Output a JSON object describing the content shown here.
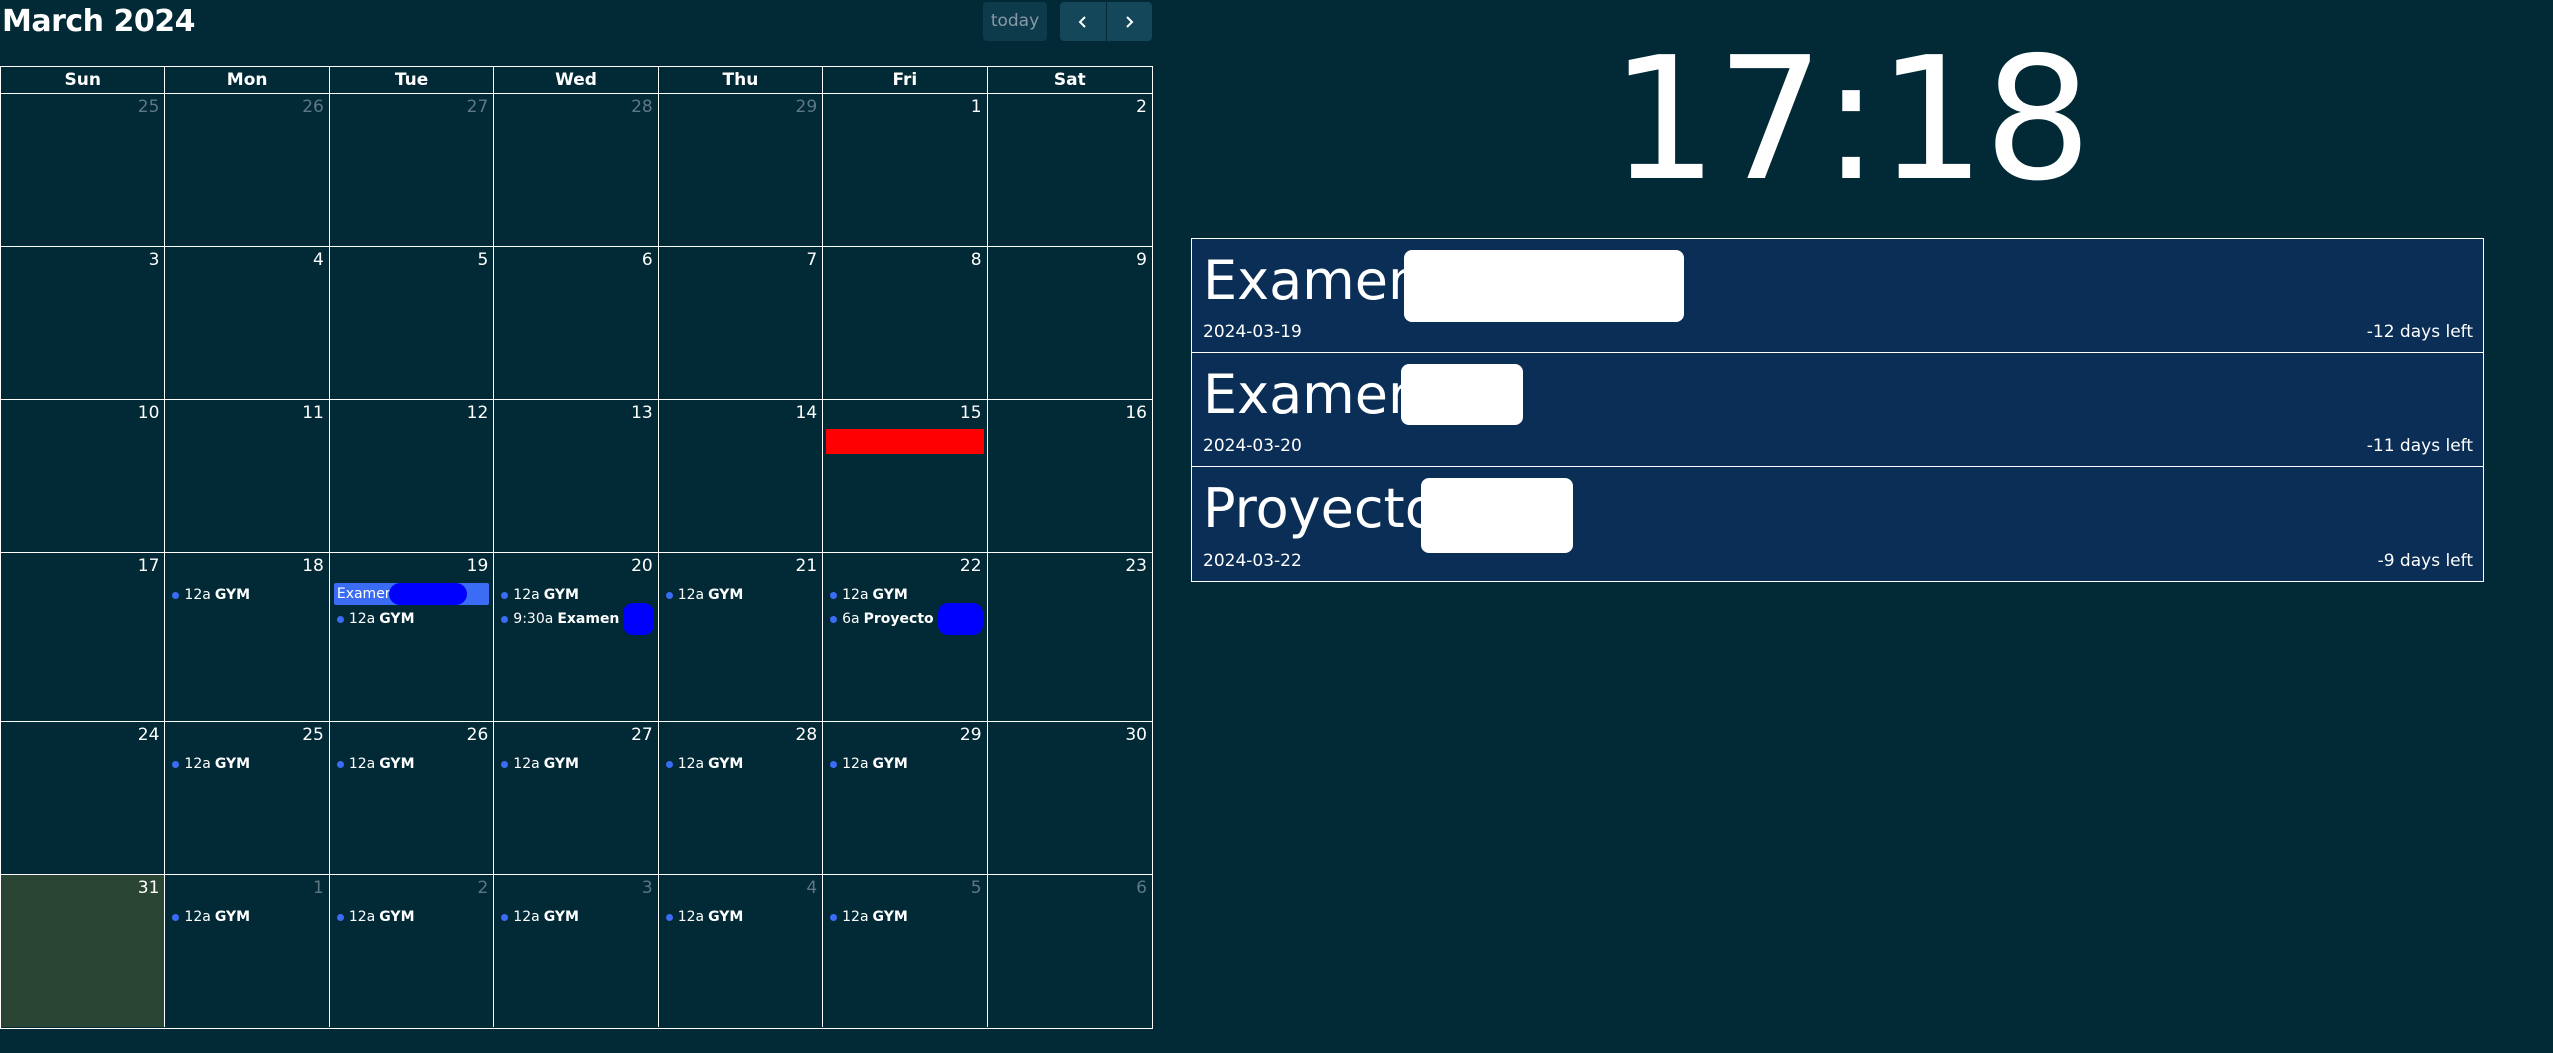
{
  "calendar": {
    "title": "March 2024",
    "today_label": "today",
    "weekdays": [
      "Sun",
      "Mon",
      "Tue",
      "Wed",
      "Thu",
      "Fri",
      "Sat"
    ],
    "weeks": [
      [
        "25",
        "26",
        "27",
        "28",
        "29",
        "1",
        "2"
      ],
      [
        "3",
        "4",
        "5",
        "6",
        "7",
        "8",
        "9"
      ],
      [
        "10",
        "11",
        "12",
        "13",
        "14",
        "15",
        "16"
      ],
      [
        "17",
        "18",
        "19",
        "20",
        "21",
        "22",
        "23"
      ],
      [
        "24",
        "25",
        "26",
        "27",
        "28",
        "29",
        "30"
      ],
      [
        "31",
        "1",
        "2",
        "3",
        "4",
        "5",
        "6"
      ]
    ],
    "event_title_gym": "GYM",
    "event_time_12a": "12a",
    "events": {
      "tue19_bar": "Examen",
      "wed20_time": "9:30a",
      "wed20_title": "Examen",
      "fri22_time": "6a",
      "fri22_title": "Proyecto"
    },
    "colors": {
      "background": "#012a36",
      "event_dot": "#3b6cf5",
      "today_cell": "#2b4535",
      "highlight_bar": "#ff0000"
    }
  },
  "clock": {
    "time": "17:18"
  },
  "countdown": {
    "items": [
      {
        "title": "Examen",
        "date": "2024-03-19",
        "left": "-12 days left"
      },
      {
        "title": "Examen",
        "date": "2024-03-20",
        "left": "-11 days left"
      },
      {
        "title": "Proyecto",
        "date": "2024-03-22",
        "left": "-9 days left"
      }
    ]
  }
}
